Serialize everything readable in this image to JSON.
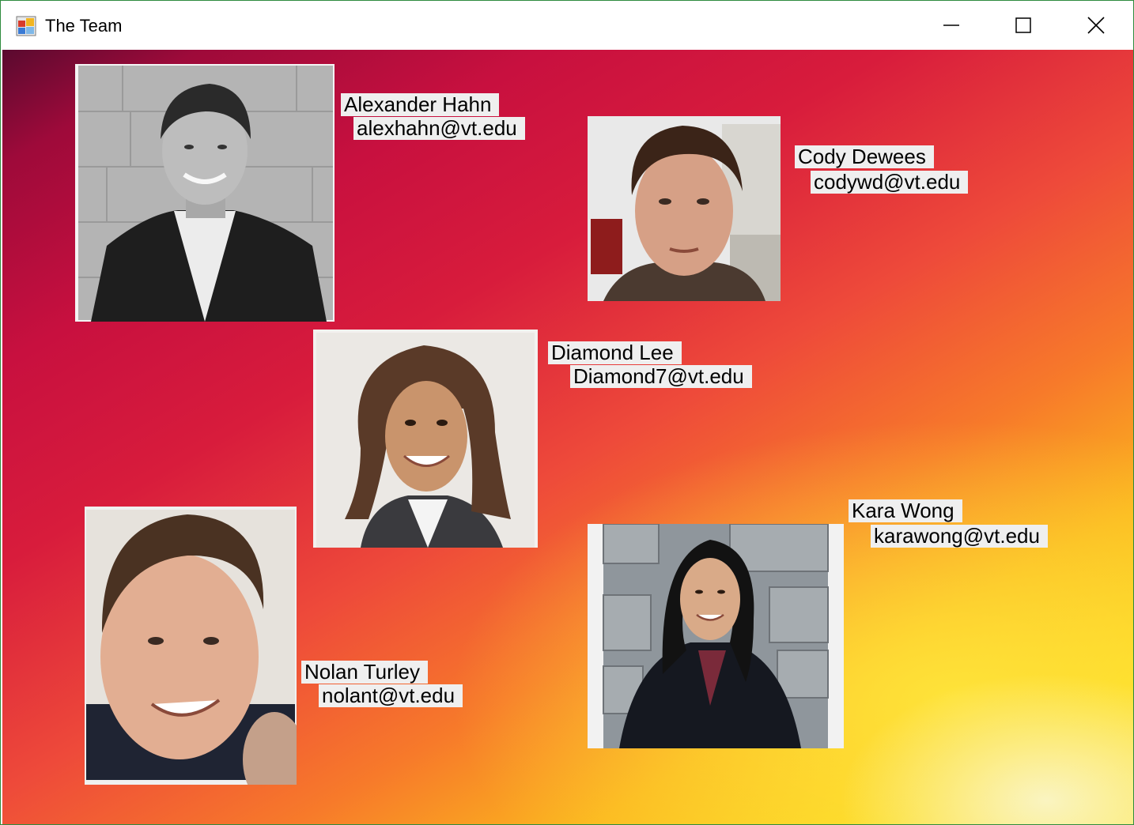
{
  "window": {
    "title": "The Team",
    "icon": "app-window-icon",
    "controls": {
      "minimize_icon": "minimize-icon",
      "maximize_icon": "maximize-icon",
      "close_icon": "close-icon"
    },
    "border_color": "#2e8b3e"
  },
  "background": {
    "gradient_colors": [
      "#5a0a2f",
      "#c8103f",
      "#ee4a3a",
      "#fbb41e",
      "#fbe95a"
    ]
  },
  "members": [
    {
      "name": "Alexander Hahn",
      "email": "alexhahn@vt.edu",
      "photo_style": "grayscale"
    },
    {
      "name": "Cody Dewees",
      "email": "codywd@vt.edu",
      "photo_style": "color"
    },
    {
      "name": "Diamond Lee",
      "email": "Diamond7@vt.edu",
      "photo_style": "color"
    },
    {
      "name": "Nolan Turley",
      "email": "nolant@vt.edu",
      "photo_style": "color"
    },
    {
      "name": "Kara Wong",
      "email": "karawong@vt.edu",
      "photo_style": "color"
    }
  ]
}
